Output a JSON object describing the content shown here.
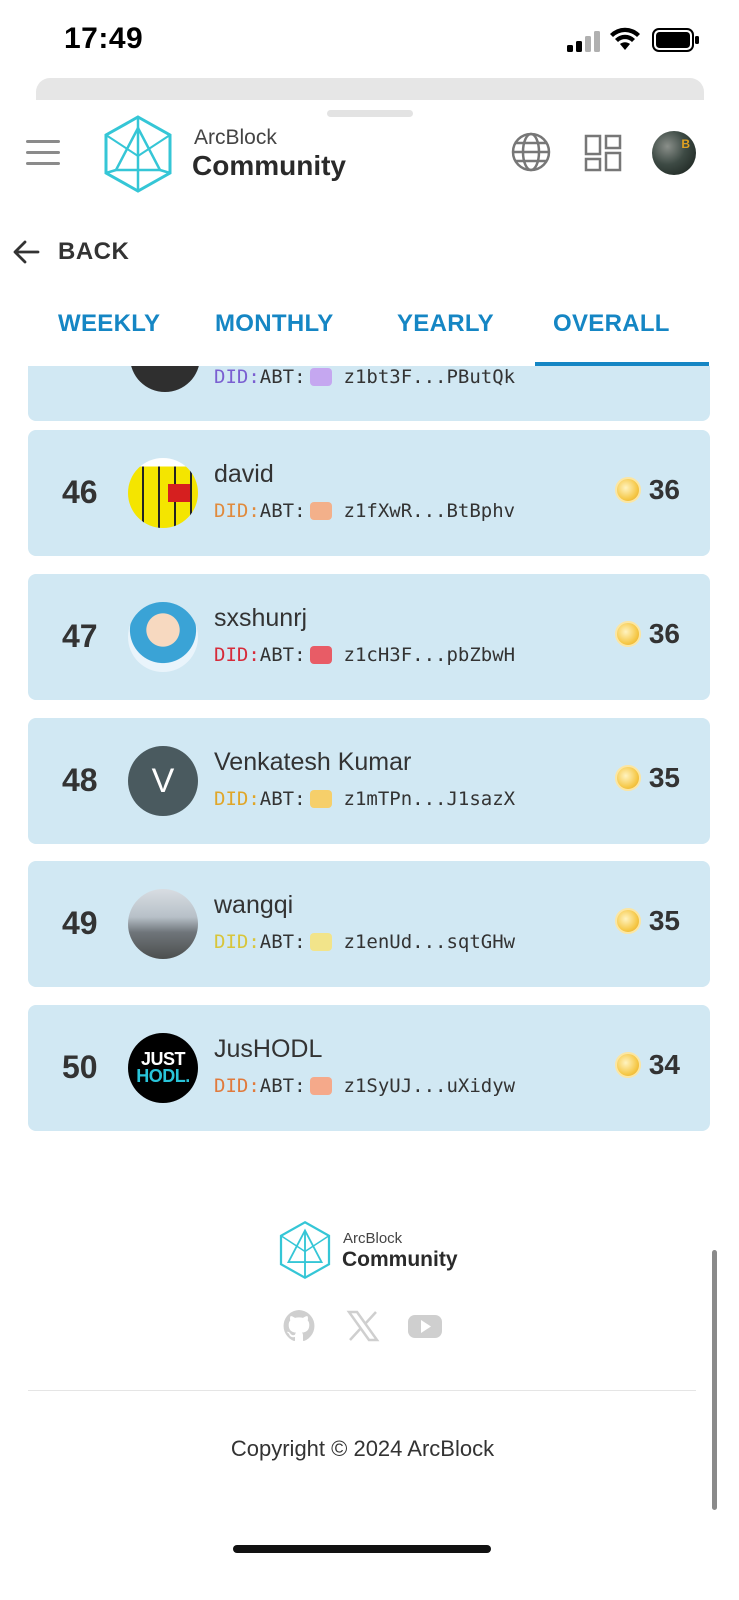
{
  "status_bar": {
    "time": "17:49"
  },
  "header": {
    "brand_top": "ArcBlock",
    "brand_bottom": "Community",
    "icons": [
      "menu-icon",
      "globe-icon",
      "apps-icon",
      "user-avatar"
    ]
  },
  "back": {
    "label": "BACK"
  },
  "tabs": [
    {
      "label": "WEEKLY",
      "active": false
    },
    {
      "label": "MONTHLY",
      "active": false
    },
    {
      "label": "YEARLY",
      "active": false
    },
    {
      "label": "OVERALL",
      "active": true
    }
  ],
  "partial_row": {
    "did_prefix": "DID:",
    "did_mid": "ABT:",
    "did_value": "z1bt3F...PButQk",
    "prefix_color": "#7a5fd1",
    "swatch_color": "#c5a7f0"
  },
  "leaderboard": [
    {
      "rank": "46",
      "name": "david",
      "did_prefix": "DID:",
      "did_mid": "ABT:",
      "did_value": "z1fXwR...BtBphv",
      "score": "36",
      "prefix_color": "#e08a3c",
      "swatch_color": "#f3b08a"
    },
    {
      "rank": "47",
      "name": "sxshunrj",
      "did_prefix": "DID:",
      "did_mid": "ABT:",
      "did_value": "z1cH3F...pbZbwH",
      "score": "36",
      "prefix_color": "#d62b3a",
      "swatch_color": "#e85c66"
    },
    {
      "rank": "48",
      "name": "Venkatesh Kumar",
      "avatar_letter": "V",
      "did_prefix": "DID:",
      "did_mid": "ABT:",
      "did_value": "z1mTPn...J1sazX",
      "score": "35",
      "prefix_color": "#e0a628",
      "swatch_color": "#f6cf6a"
    },
    {
      "rank": "49",
      "name": "wangqi",
      "did_prefix": "DID:",
      "did_mid": "ABT:",
      "did_value": "z1enUd...sqtGHw",
      "score": "35",
      "prefix_color": "#d8c53a",
      "swatch_color": "#f2e48a"
    },
    {
      "rank": "50",
      "name": "JusHODL",
      "avatar_text_top": "JUST",
      "avatar_text_bottom": "HODL.",
      "did_prefix": "DID:",
      "did_mid": "ABT:",
      "did_value": "z1SyUJ...uXidyw",
      "score": "34",
      "prefix_color": "#e07a3c",
      "swatch_color": "#f5a98a"
    }
  ],
  "footer": {
    "brand_top": "ArcBlock",
    "brand_bottom": "Community",
    "social_icons": [
      "github-icon",
      "x-icon",
      "youtube-icon"
    ],
    "copyright": "Copyright © 2024 ArcBlock"
  }
}
